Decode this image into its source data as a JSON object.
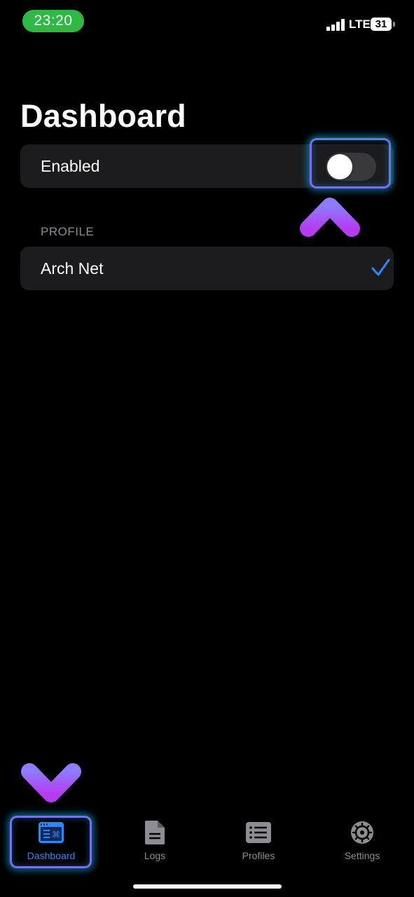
{
  "status_bar": {
    "time": "23:20",
    "network": "LTE",
    "battery": "31",
    "time_pill_color": "#2fb944"
  },
  "page": {
    "title": "Dashboard"
  },
  "enabled_cell": {
    "label": "Enabled",
    "toggle_on": false
  },
  "profile_section": {
    "header": "PROFILE",
    "items": [
      {
        "label": "Arch Net",
        "selected": true
      }
    ]
  },
  "tab_bar": {
    "active_color": "#2f87ff",
    "inactive_color": "#8d8d93",
    "tabs": [
      {
        "label": "Dashboard",
        "icon": "dashboard-icon",
        "active": true
      },
      {
        "label": "Logs",
        "icon": "document-icon",
        "active": false
      },
      {
        "label": "Profiles",
        "icon": "list-icon",
        "active": false
      },
      {
        "label": "Settings",
        "icon": "gear-icon",
        "active": false
      }
    ]
  },
  "annotations": {
    "highlight_color": "#7a6ff0",
    "arrow_colors": [
      "#8f7bff",
      "#b63cf0"
    ]
  }
}
